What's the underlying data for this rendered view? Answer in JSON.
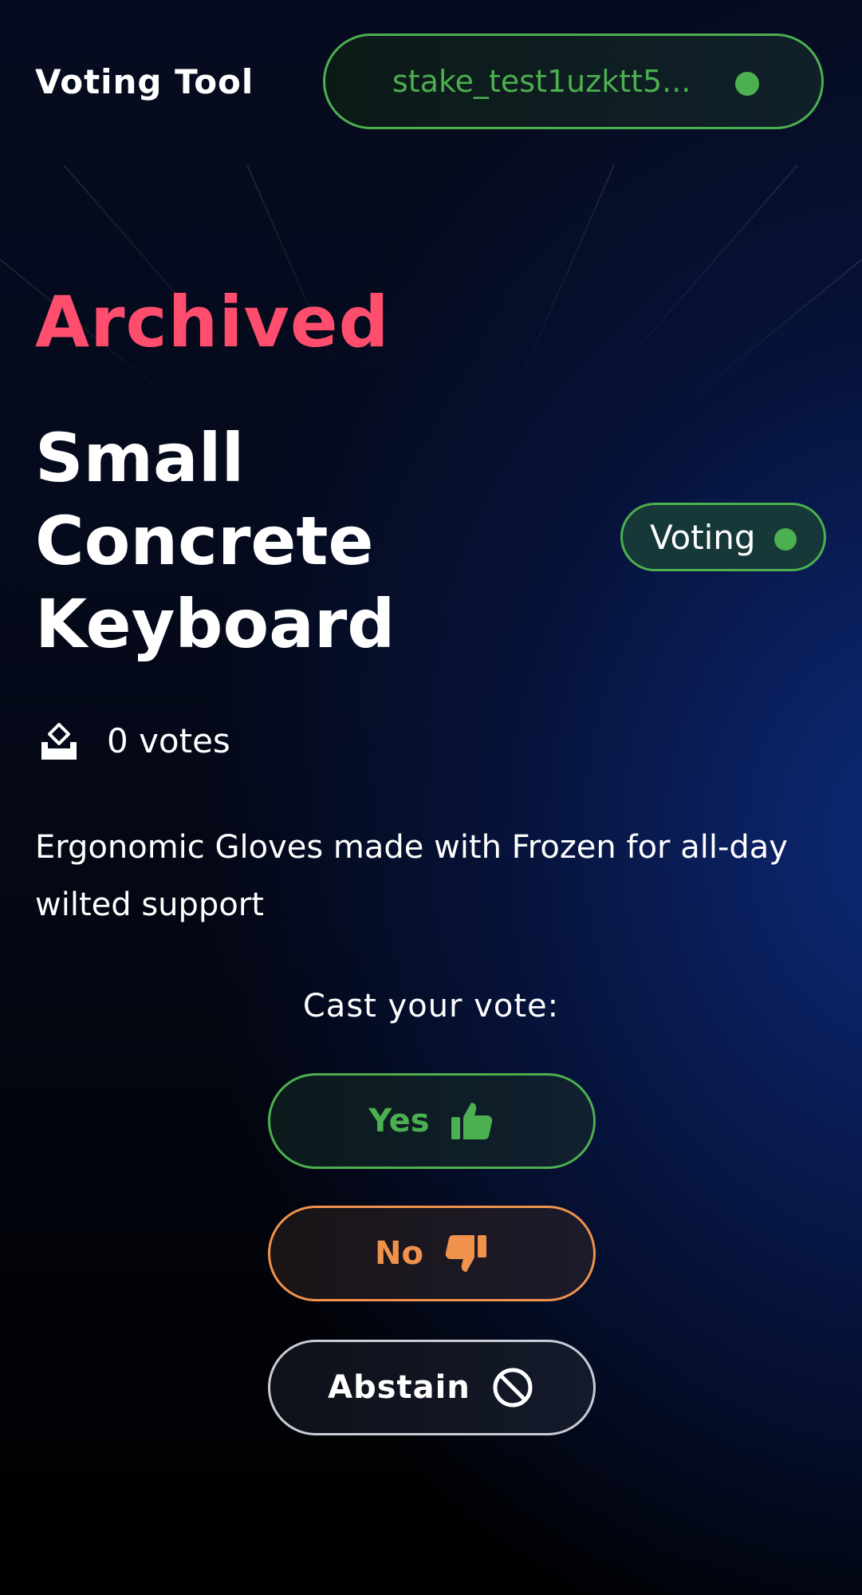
{
  "header": {
    "app_title": "Voting Tool",
    "wallet_address": "stake_test1uzktt5...",
    "wallet_status_color": "#4caf50"
  },
  "proposal": {
    "archive_state": "Archived",
    "title": "Small Concrete Keyboard",
    "status": "Voting",
    "votes": "0 votes",
    "description": "Ergonomic Gloves made with Frozen for all-day wilted support"
  },
  "vote": {
    "prompt": "Cast your  vote:",
    "options": [
      {
        "label": "Yes",
        "icon": "thumbs-up-icon",
        "color": "#4caf50"
      },
      {
        "label": "No",
        "icon": "thumbs-down-icon",
        "color": "#f0924c"
      },
      {
        "label": "Abstain",
        "icon": "prohibited-icon",
        "color": "#ffffff"
      }
    ]
  },
  "colors": {
    "accent_green": "#4caf50",
    "archived_red": "#ff4d6d",
    "no_orange": "#f0924c"
  }
}
